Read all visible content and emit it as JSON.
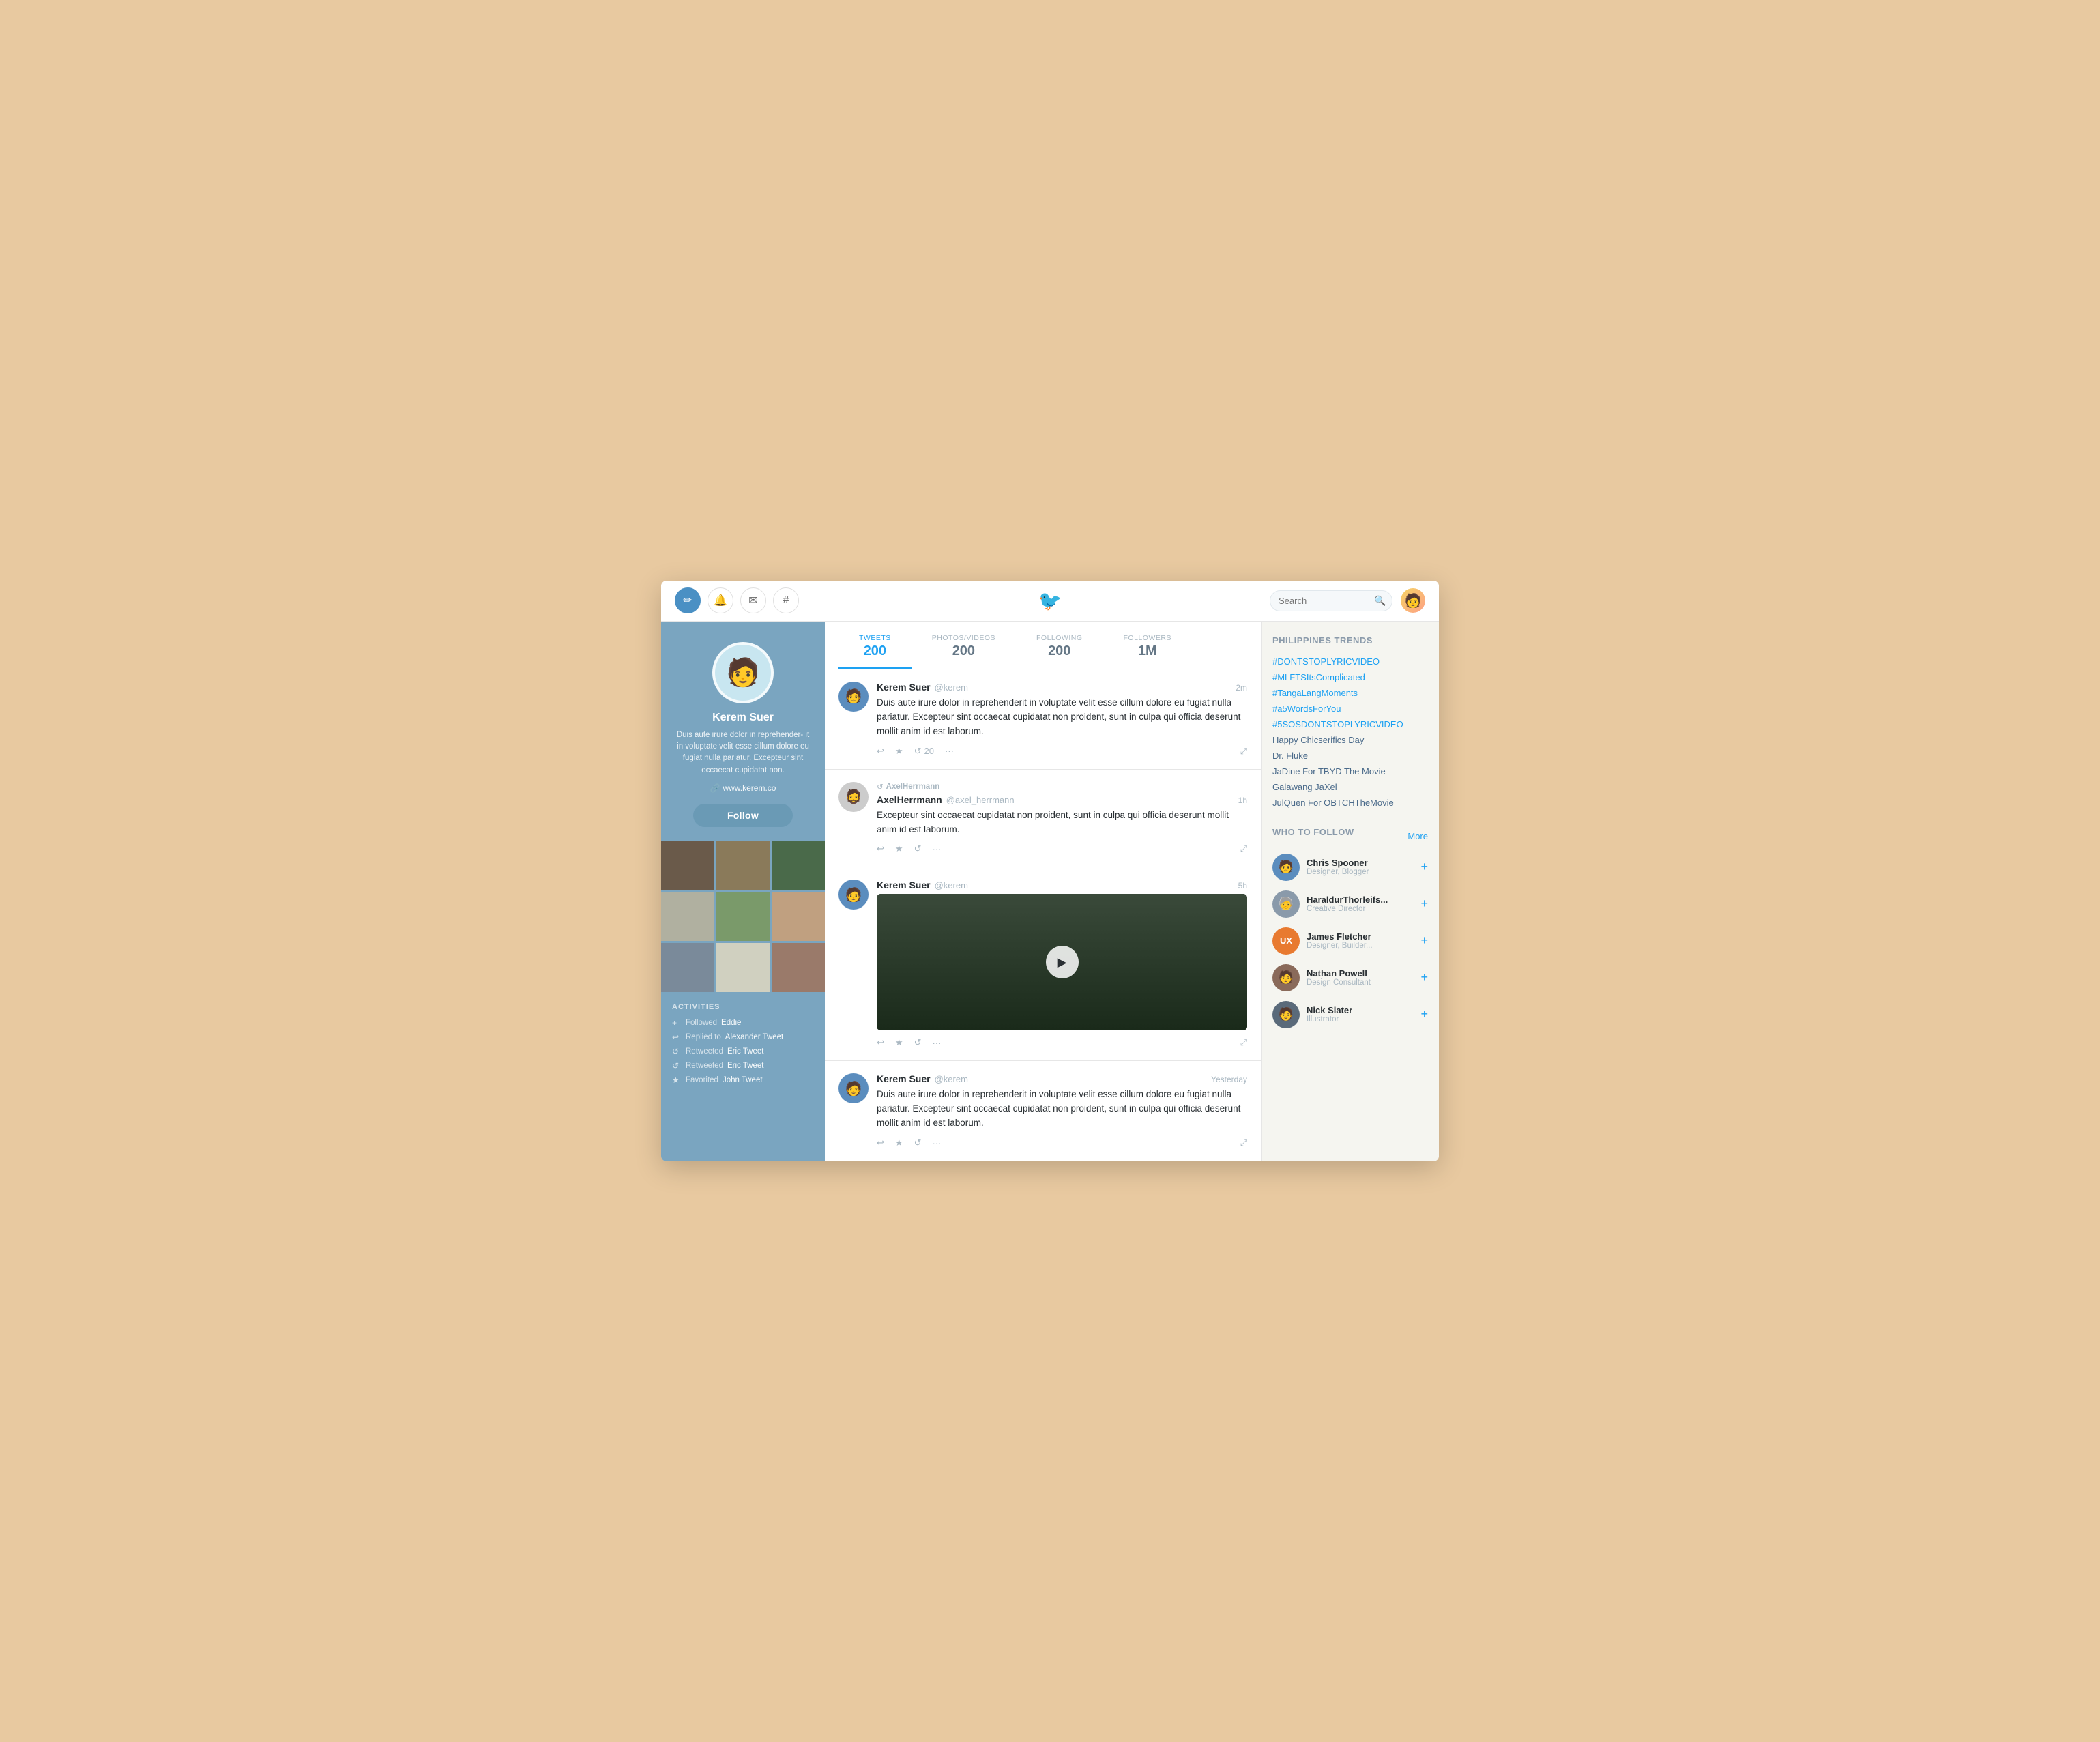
{
  "nav": {
    "icons": [
      "pencil",
      "bell",
      "envelope",
      "hashtag"
    ],
    "search_placeholder": "Search",
    "brand": "🐦"
  },
  "tabs": [
    {
      "label": "TWEETS",
      "count": "200",
      "active": true
    },
    {
      "label": "PHOTOS/VIDEOS",
      "count": "200",
      "active": false
    },
    {
      "label": "FOLLOWING",
      "count": "200",
      "active": false
    },
    {
      "label": "FOLLOWERS",
      "count": "1M",
      "active": false
    }
  ],
  "profile": {
    "name": "Kerem Suer",
    "bio": "Duis aute irure dolor in reprehender- it in voluptate velit esse cillum dolore eu fugiat nulla pariatur. Excepteur sint occaecat cupidatat non.",
    "link": "www.kerem.co",
    "follow_label": "Follow"
  },
  "activities": {
    "title": "ACTIVITIES",
    "items": [
      {
        "icon": "+",
        "prefix": "Followed",
        "link": "Eddie"
      },
      {
        "icon": "↩",
        "prefix": "Replied to",
        "link": "Alexander Tweet"
      },
      {
        "icon": "↺",
        "prefix": "Retweeted",
        "link": "Eric Tweet"
      },
      {
        "icon": "↺",
        "prefix": "Retweeted",
        "link": "Eric Tweet"
      },
      {
        "icon": "★",
        "prefix": "Favorited",
        "link": "John Tweet"
      }
    ]
  },
  "tweets": [
    {
      "name": "Kerem Suer",
      "handle": "@kerem",
      "time": "2m",
      "text": "Duis aute irure dolor in reprehenderit in voluptate velit esse cillum dolore eu fugiat nulla pariatur. Excepteur sint occaecat cupidatat non proident, sunt in culpa qui officia deserunt mollit anim id est laborum.",
      "retweet_count": "20",
      "has_video": false,
      "type": "normal"
    },
    {
      "name": "AxelHerrmann",
      "handle": "@axel_herrmann",
      "time": "1h",
      "text": "Excepteur sint occaecat cupidatat non proident, sunt in culpa qui officia deserunt mollit anim id est laborum.",
      "retweet_count": "",
      "has_video": false,
      "type": "retweet"
    },
    {
      "name": "Kerem Suer",
      "handle": "@kerem",
      "time": "5h",
      "text": "",
      "retweet_count": "",
      "has_video": true,
      "type": "video"
    },
    {
      "name": "Kerem Suer",
      "handle": "@kerem",
      "time": "Yesterday",
      "text": "Duis aute irure dolor in reprehenderit in voluptate velit esse cillum dolore eu fugiat nulla pariatur. Excepteur sint occaecat cupidatat non proident, sunt in culpa qui officia deserunt mollit anim id est laborum.",
      "retweet_count": "",
      "has_video": false,
      "type": "normal"
    }
  ],
  "trends": {
    "title": "PHILIPPINES TRENDS",
    "items": [
      {
        "text": "#DONTSTOPLYRICVIDEO",
        "type": "hashtag"
      },
      {
        "text": "#MLFTSItsComplicated",
        "type": "hashtag"
      },
      {
        "text": "#TangaLangMoments",
        "type": "hashtag"
      },
      {
        "text": "#a5WordsForYou",
        "type": "hashtag"
      },
      {
        "text": "#5SOSDONTSTOPLYRICVIDEO",
        "type": "hashtag"
      },
      {
        "text": "Happy Chicserifics Day",
        "type": "regular"
      },
      {
        "text": "Dr. Fluke",
        "type": "regular"
      },
      {
        "text": "JaDine For TBYD The Movie",
        "type": "regular"
      },
      {
        "text": "Galawang JaXel",
        "type": "regular"
      },
      {
        "text": "JulQuen For OBTCHTheMovie",
        "type": "regular"
      }
    ]
  },
  "who_to_follow": {
    "title": "WHO TO FOLLOW",
    "more_label": "More",
    "suggestions": [
      {
        "name": "Chris Spooner",
        "desc": "Designer, Blogger",
        "color": "av-blue"
      },
      {
        "name": "HaraldurThorleifs...",
        "desc": "Creative Director",
        "color": "av-gray"
      },
      {
        "name": "James Fletcher",
        "desc": "Designer, Builder...",
        "color": "av-orange"
      },
      {
        "name": "Nathan Powell",
        "desc": "Design Consultant",
        "color": "av-brown"
      },
      {
        "name": "Nick Slater",
        "desc": "Illustrator",
        "color": "av-dark"
      }
    ]
  }
}
